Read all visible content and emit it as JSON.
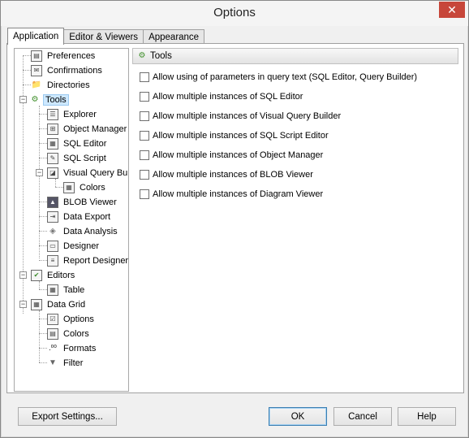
{
  "window": {
    "title": "Options",
    "close_icon": "close-icon",
    "close_color": "#c7463a"
  },
  "tabs": [
    {
      "label": "Application",
      "active": true
    },
    {
      "label": "Editor & Viewers",
      "active": false
    },
    {
      "label": "Appearance",
      "active": false
    }
  ],
  "tree": {
    "items": [
      {
        "label": "Preferences",
        "icon": "preferences-icon"
      },
      {
        "label": "Confirmations",
        "icon": "confirmations-icon"
      },
      {
        "label": "Directories",
        "icon": "folder-icon"
      },
      {
        "label": "Tools",
        "icon": "tools-icon",
        "selected": true,
        "expanded": true
      },
      {
        "label": "Explorer",
        "icon": "explorer-icon"
      },
      {
        "label": "Object Manager",
        "icon": "object-manager-icon"
      },
      {
        "label": "SQL Editor",
        "icon": "sql-editor-icon"
      },
      {
        "label": "SQL Script",
        "icon": "sql-script-icon"
      },
      {
        "label": "Visual Query Builder",
        "icon": "query-builder-icon",
        "expanded": true
      },
      {
        "label": "Colors",
        "icon": "grid-icon"
      },
      {
        "label": "BLOB Viewer",
        "icon": "blob-viewer-icon"
      },
      {
        "label": "Data Export",
        "icon": "data-export-icon"
      },
      {
        "label": "Data Analysis",
        "icon": "data-analysis-icon"
      },
      {
        "label": "Designer",
        "icon": "designer-icon"
      },
      {
        "label": "Report Designer",
        "icon": "report-designer-icon"
      },
      {
        "label": "Editors",
        "icon": "editors-icon",
        "expanded": true
      },
      {
        "label": "Table",
        "icon": "table-icon"
      },
      {
        "label": "Data Grid",
        "icon": "data-grid-icon",
        "expanded": true
      },
      {
        "label": "Options",
        "icon": "options-icon"
      },
      {
        "label": "Colors",
        "icon": "colors-icon"
      },
      {
        "label": "Formats",
        "icon": "formats-icon"
      },
      {
        "label": "Filter",
        "icon": "filter-icon"
      }
    ]
  },
  "panel": {
    "header": "Tools",
    "header_icon": "tools-icon",
    "options": [
      {
        "label": "Allow using of parameters in query text (SQL Editor, Query Builder)",
        "checked": false
      },
      {
        "label": "Allow multiple instances of SQL Editor",
        "checked": false
      },
      {
        "label": "Allow multiple instances of Visual Query Builder",
        "checked": false
      },
      {
        "label": "Allow multiple instances of SQL Script Editor",
        "checked": false
      },
      {
        "label": "Allow multiple instances of Object Manager",
        "checked": false
      },
      {
        "label": "Allow multiple instances of BLOB Viewer",
        "checked": false
      },
      {
        "label": "Allow multiple instances of Diagram Viewer",
        "checked": false
      }
    ]
  },
  "buttons": {
    "export": "Export Settings...",
    "ok": "OK",
    "cancel": "Cancel",
    "help": "Help"
  },
  "colors": {
    "selection": "#cde8ff",
    "default_button_border": "#3c7fb1"
  }
}
